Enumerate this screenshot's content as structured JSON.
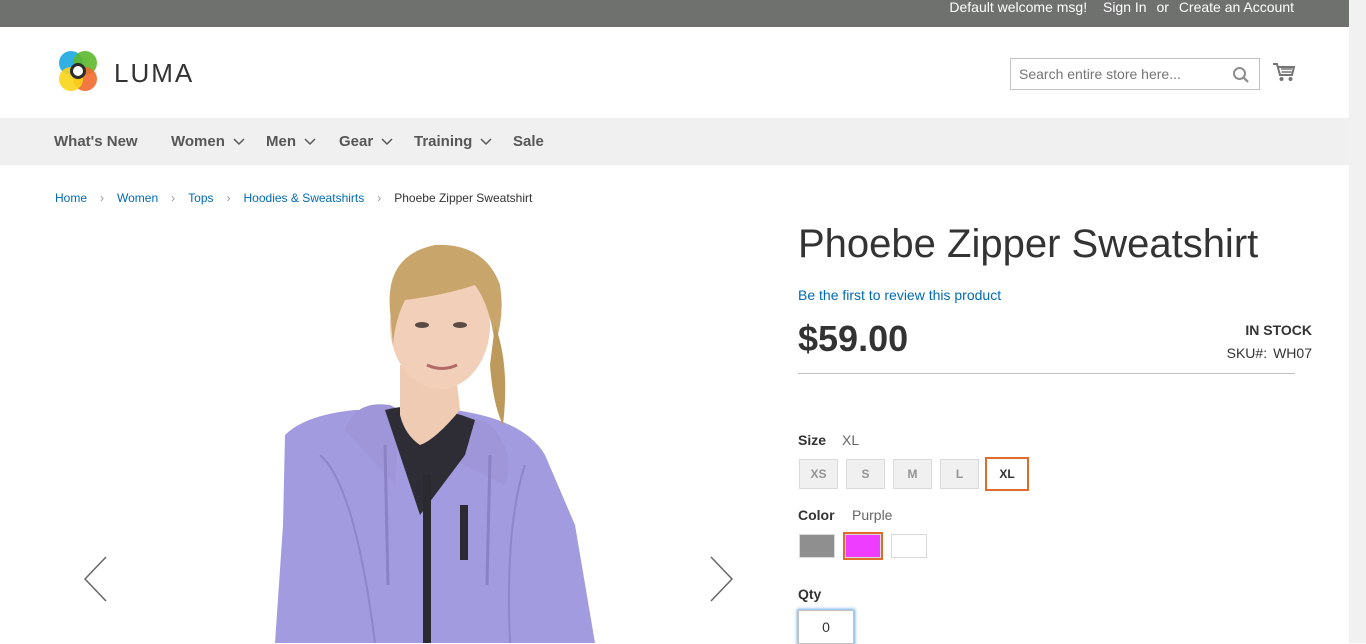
{
  "topbar": {
    "welcome": "Default welcome msg!",
    "sign_in": "Sign In",
    "or": "or",
    "create_account": "Create an Account"
  },
  "header": {
    "logo_text": "LUMA",
    "search_placeholder": "Search entire store here..."
  },
  "nav": {
    "items": [
      {
        "label": "What's New"
      },
      {
        "label": "Women"
      },
      {
        "label": "Men"
      },
      {
        "label": "Gear"
      },
      {
        "label": "Training"
      },
      {
        "label": "Sale"
      }
    ]
  },
  "breadcrumb": {
    "items": [
      "Home",
      "Women",
      "Tops",
      "Hoodies & Sweatshirts"
    ],
    "current": "Phoebe Zipper Sweatshirt"
  },
  "product": {
    "title": "Phoebe Zipper Sweatshirt",
    "review_link": "Be the first to review this product",
    "price": "$59.00",
    "stock": "IN STOCK",
    "sku_label": "SKU#:",
    "sku": "WH07"
  },
  "options": {
    "size_label": "Size",
    "size_selected": "XL",
    "sizes": [
      "XS",
      "S",
      "M",
      "L",
      "XL"
    ],
    "color_label": "Color",
    "color_selected": "Purple",
    "colors": [
      "#8f8f8f",
      "#ef3dff",
      "#ffffff"
    ],
    "qty_label": "Qty",
    "qty_value": "0"
  },
  "colors": {
    "topbar_bg": "#6e716e",
    "link": "#006bb4",
    "accent": "#e06c2c",
    "nav_bg": "#f0f0f0"
  }
}
